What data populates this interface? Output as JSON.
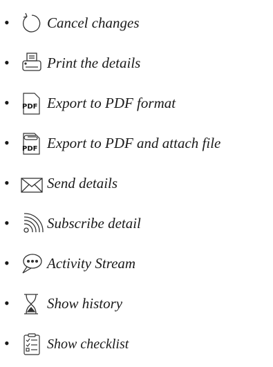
{
  "menu": {
    "items": [
      {
        "label": "Cancel changes",
        "icon": "undo-icon"
      },
      {
        "label": "Print the details",
        "icon": "printer-icon"
      },
      {
        "label": "Export to PDF format",
        "icon": "pdf-icon"
      },
      {
        "label": "Export to PDF and attach file",
        "icon": "pdf-attach-icon"
      },
      {
        "label": "Send details",
        "icon": "envelope-icon"
      },
      {
        "label": "Subscribe detail",
        "icon": "rss-icon"
      },
      {
        "label": "Activity Stream",
        "icon": "chat-bubble-icon"
      },
      {
        "label": "Show history",
        "icon": "hourglass-icon"
      },
      {
        "label": "Show checklist",
        "icon": "checklist-icon"
      }
    ]
  }
}
